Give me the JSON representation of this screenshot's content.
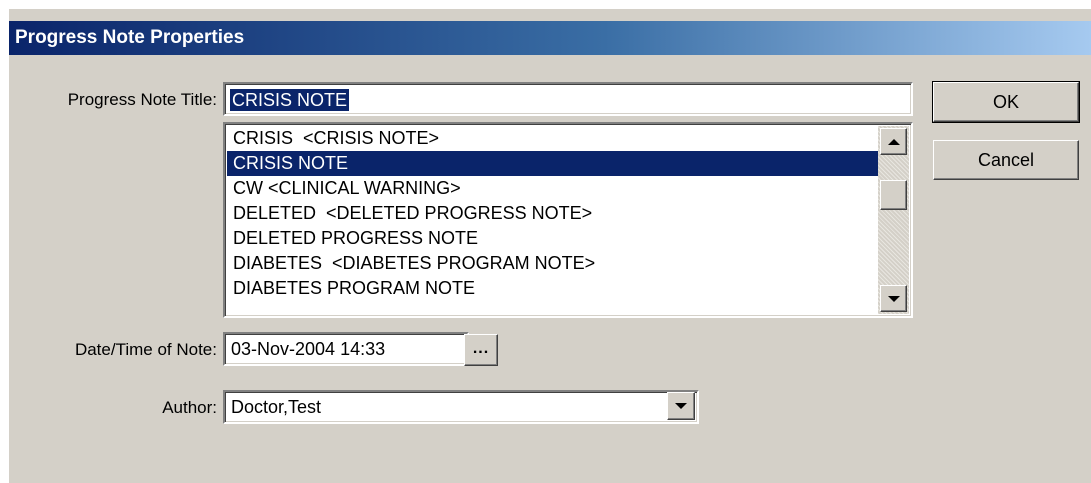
{
  "window": {
    "title": "Progress Note Properties"
  },
  "form": {
    "title_label": "Progress Note Title:",
    "title_value": "CRISIS NOTE",
    "list_items": [
      "CRISIS  <CRISIS NOTE>",
      "CRISIS NOTE",
      "CW <CLINICAL WARNING>",
      "DELETED  <DELETED PROGRESS NOTE>",
      "DELETED PROGRESS NOTE",
      "DIABETES  <DIABETES PROGRAM NOTE>",
      "DIABETES PROGRAM NOTE"
    ],
    "selected_item": "CRISIS NOTE",
    "date_label": "Date/Time of Note:",
    "date_value": "03-Nov-2004 14:33",
    "ellipsis_label": "...",
    "author_label": "Author:",
    "author_value": "Doctor,Test"
  },
  "buttons": {
    "ok": "OK",
    "cancel": "Cancel"
  },
  "colors": {
    "face": "#d4d0c8",
    "selection": "#0a246a",
    "title_gradient_start": "#0a246a",
    "title_gradient_end": "#a6caf0"
  }
}
